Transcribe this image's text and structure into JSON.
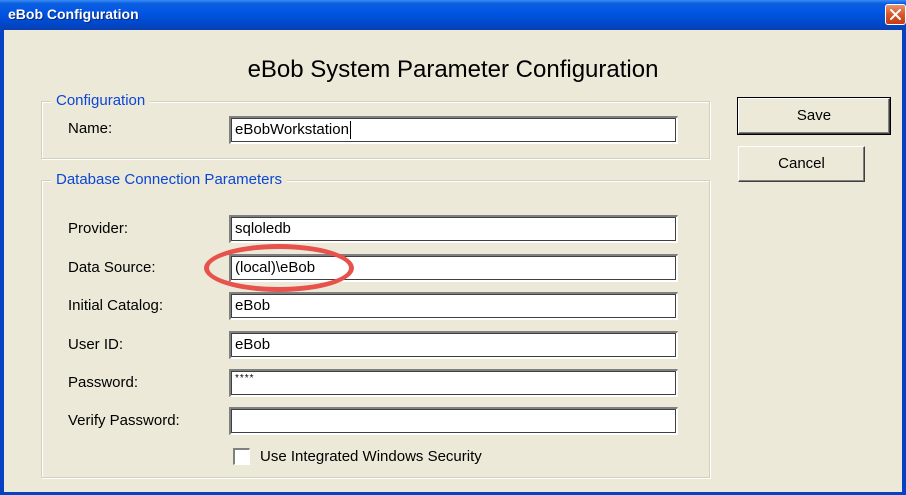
{
  "window": {
    "title": "eBob Configuration"
  },
  "heading": "eBob System Parameter Configuration",
  "configuration_group": {
    "legend": "Configuration",
    "name_label": "Name:",
    "name_value": "eBobWorkstation"
  },
  "connection_group": {
    "legend": "Database Connection Parameters",
    "fields": [
      {
        "label": "Provider:",
        "value": "sqloledb"
      },
      {
        "label": "Data Source:",
        "value": "(local)\\eBob"
      },
      {
        "label": "Initial Catalog:",
        "value": "eBob"
      },
      {
        "label": "User ID:",
        "value": "eBob"
      },
      {
        "label": "Password:",
        "value": "****"
      },
      {
        "label": "Verify Password:",
        "value": ""
      }
    ],
    "integrated_security_label": "Use Integrated Windows Security",
    "integrated_security_checked": false
  },
  "buttons": {
    "save_label": "Save",
    "cancel_label": "Cancel"
  },
  "colors": {
    "titlebar": "#0054e3",
    "legend_text": "#0b46d4",
    "window_bg": "#ece9d8",
    "highlight": "#e8524d"
  },
  "icons": {
    "close": "close-icon"
  }
}
